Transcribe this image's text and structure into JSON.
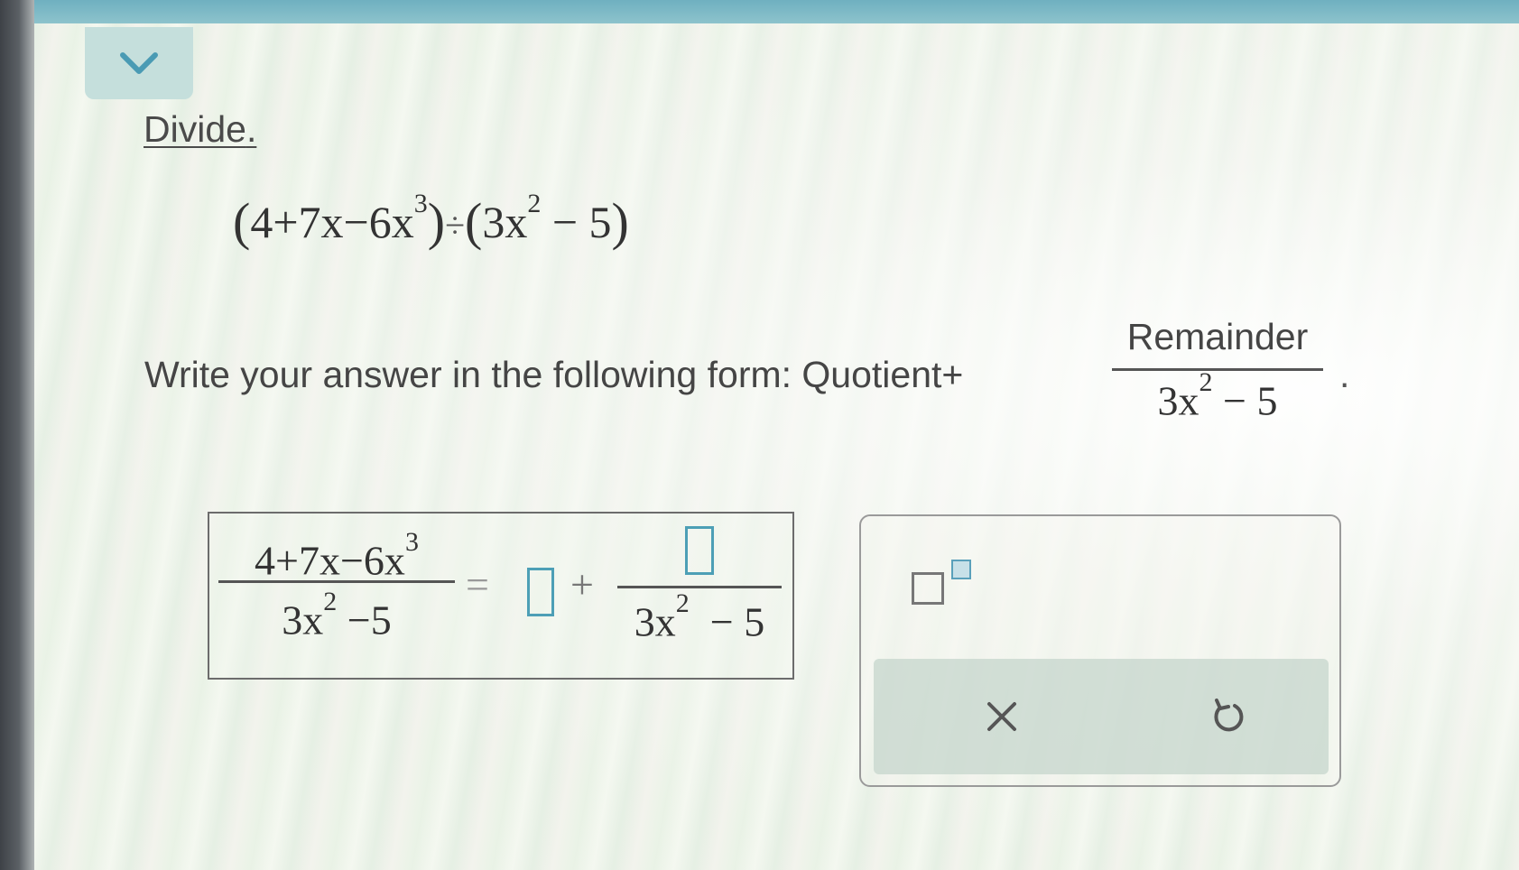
{
  "header": {
    "collapse_icon": "chevron-down-icon"
  },
  "problem": {
    "instruction_link": "Divide",
    "instruction_period": ".",
    "expression": {
      "dividend_terms": "4+7x−6x",
      "dividend_exp": "3",
      "divide_symbol": "÷",
      "divisor_lead": "3x",
      "divisor_exp": "2",
      "divisor_tail": " − 5"
    }
  },
  "instruction": {
    "text": "Write your answer in the following form: Quotient+",
    "fraction_numerator": "Remainder",
    "fraction_den_lead": "3x",
    "fraction_den_exp": "2",
    "fraction_den_tail": " − 5",
    "trailing_period": "."
  },
  "answer": {
    "lhs_num_lead": "4+7x−6x",
    "lhs_num_exp": "3",
    "lhs_den_lead": "3x",
    "lhs_den_exp": "2",
    "lhs_den_tail": " −5",
    "equals": "=",
    "plus": "+",
    "rhs_den_lead": "3x",
    "rhs_den_exp": "2",
    "rhs_den_tail": "  − 5",
    "quotient_value": "",
    "remainder_value": ""
  },
  "toolbar": {
    "exponent_icon": "exponent-template-icon",
    "clear_symbol": "×",
    "clear_icon": "close-icon",
    "undo_icon": "undo-icon"
  },
  "colors": {
    "input_border": "#4d9fb6",
    "top_bar": "#7ab8c6",
    "tool_strip": "#c6d6cc"
  }
}
